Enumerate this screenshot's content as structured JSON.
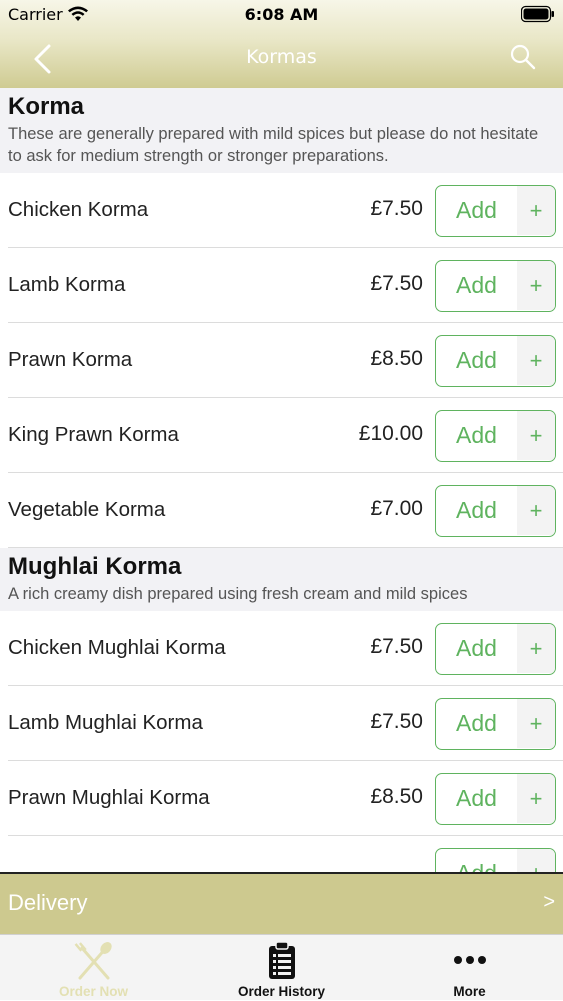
{
  "status_bar": {
    "carrier": "Carrier",
    "time": "6:08 AM"
  },
  "nav": {
    "title": "Kormas"
  },
  "sections": [
    {
      "title": "Korma",
      "description": "These are generally prepared with mild spices but please do not hesitate to ask for medium strength or stronger preparations.",
      "items": [
        {
          "name": "Chicken Korma",
          "price": "£7.50"
        },
        {
          "name": "Lamb Korma",
          "price": "£7.50"
        },
        {
          "name": "Prawn Korma",
          "price": "£8.50"
        },
        {
          "name": "King Prawn Korma",
          "price": "£10.00"
        },
        {
          "name": "Vegetable Korma",
          "price": "£7.00"
        }
      ]
    },
    {
      "title": "Mughlai Korma",
      "description": "A rich creamy dish prepared using fresh cream and mild spices",
      "items": [
        {
          "name": "Chicken Mughlai Korma",
          "price": "£7.50"
        },
        {
          "name": "Lamb Mughlai Korma",
          "price": "£7.50"
        },
        {
          "name": "Prawn Mughlai Korma",
          "price": "£8.50"
        },
        {
          "name": "",
          "price": ""
        }
      ]
    }
  ],
  "add_button": {
    "label": "Add",
    "plus": "+"
  },
  "delivery": {
    "label": "Delivery",
    "arrow": ">"
  },
  "tabs": [
    {
      "label": "Order Now",
      "icon": "fork-spoon-icon",
      "color": "#e3e0b3"
    },
    {
      "label": "Order History",
      "icon": "clipboard-list-icon",
      "color": "#111111"
    },
    {
      "label": "More",
      "icon": "more-dots-icon",
      "color": "#111111"
    }
  ],
  "colors": {
    "accent_green": "#5fb35f",
    "header_olive": "#cdc98f"
  }
}
